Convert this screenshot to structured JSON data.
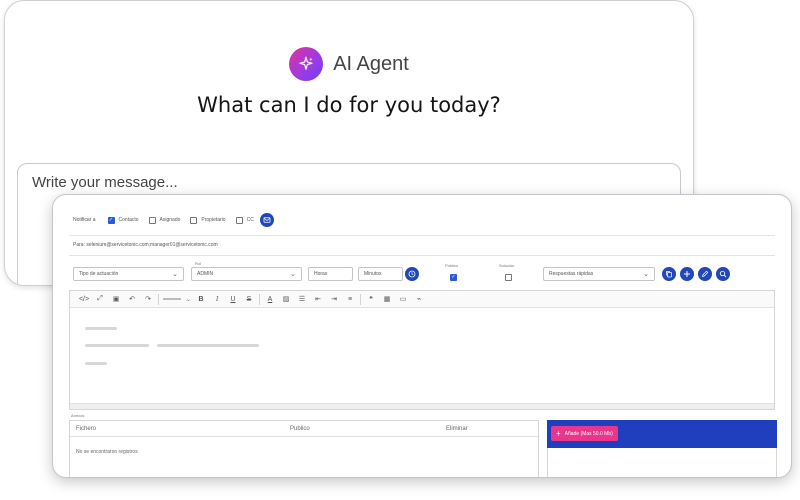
{
  "agent": {
    "name": "AI Agent",
    "question": "What can I do for you today?",
    "message_placeholder": "Write your message..."
  },
  "ticket": {
    "notify_label": "Notificar a",
    "notify_options": [
      {
        "label": "Contacto",
        "checked": true
      },
      {
        "label": "Asignado",
        "checked": false
      },
      {
        "label": "Propietario",
        "checked": false
      },
      {
        "label": "CC",
        "checked": false
      }
    ],
    "to_line": "Para: selenium@servicetonic.com;manager01@servicetonic.com",
    "activity_type_placeholder": "Tipo de actuación",
    "role_label": "Rol",
    "role_value": "ADMIN",
    "hours_placeholder": "Horas",
    "minutes_placeholder": "Minutos",
    "public_label": "Público",
    "public_checked": true,
    "solution_label": "Solución",
    "solution_checked": false,
    "quick_answers_placeholder": "Respuestas rápidas",
    "attachments_label": "Anexos",
    "attachments_columns": [
      "Fichero",
      "Publico",
      "Eliminar"
    ],
    "attachments_empty": "No se encontraron registros",
    "upload_button": "Añade (Max 50.0 Mb)"
  },
  "colors": {
    "accent_blue": "#2147b8",
    "upload_panel": "#1f3fbe",
    "upload_button": "#e8368a",
    "logo_gradient_start": "#e0329a",
    "logo_gradient_end": "#6a3ff0"
  }
}
